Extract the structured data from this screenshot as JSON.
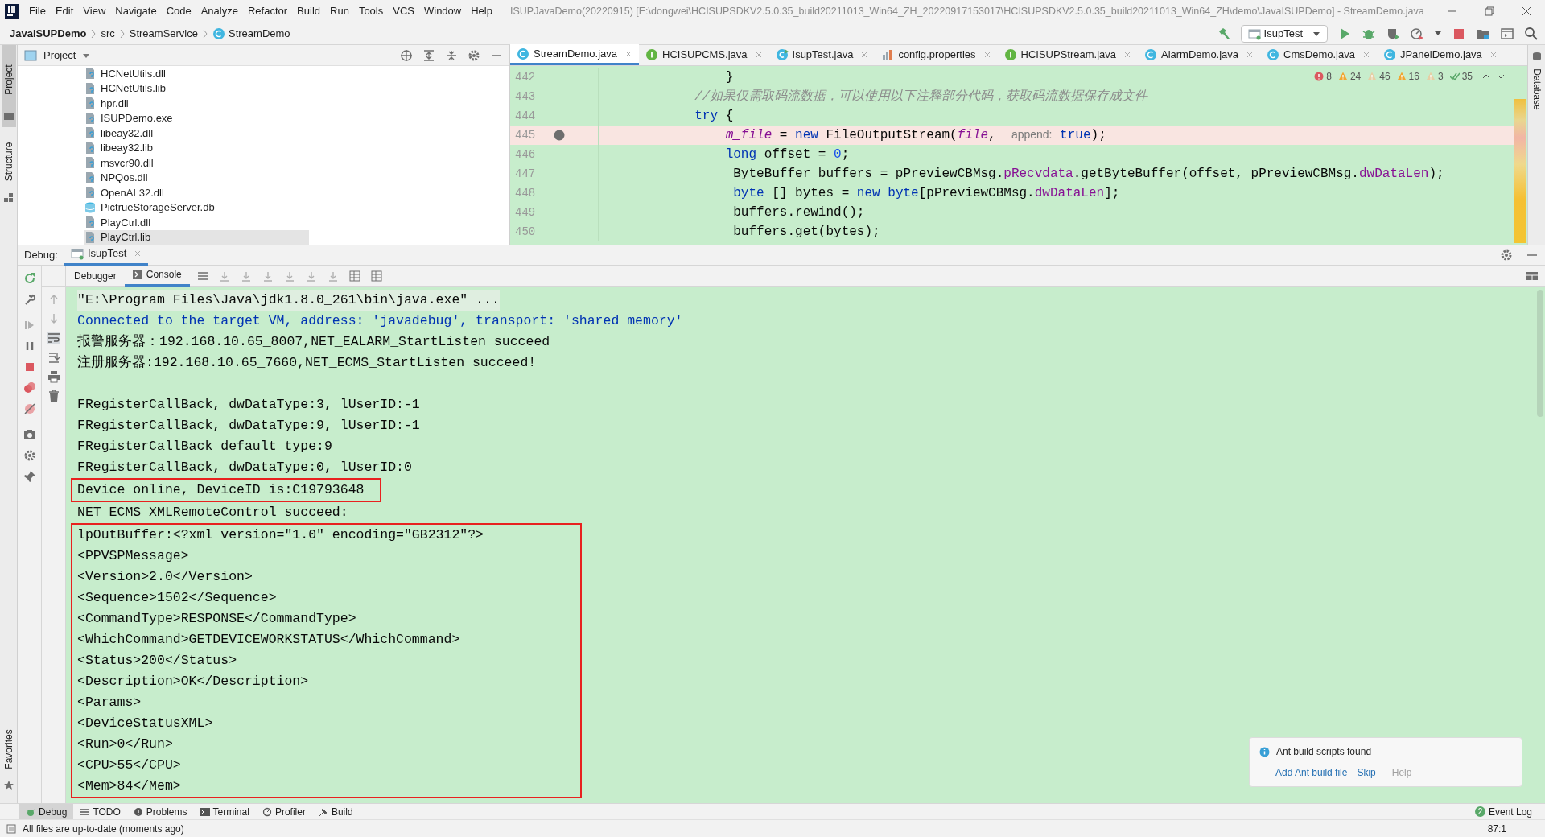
{
  "menu": [
    "File",
    "Edit",
    "View",
    "Navigate",
    "Code",
    "Analyze",
    "Refactor",
    "Build",
    "Run",
    "Tools",
    "VCS",
    "Window",
    "Help"
  ],
  "window": {
    "title": "ISUPJavaDemo(20220915) [E:\\dongwei\\HCISUPSDKV2.5.0.35_build20211013_Win64_ZH_20220917153017\\HCISUPSDKV2.5.0.35_build20211013_Win64_ZH\\demo\\JavaISUPDemo] - StreamDemo.java"
  },
  "breadcrumbs": [
    {
      "label": "JavaISUPDemo",
      "kind": "project"
    },
    {
      "label": "src",
      "kind": "folder"
    },
    {
      "label": "StreamService",
      "kind": "folder"
    },
    {
      "label": "StreamDemo",
      "kind": "class"
    }
  ],
  "run_config": "IsupTest",
  "left_strip": [
    "Project",
    "Structure"
  ],
  "project": {
    "title": "Project",
    "items": [
      {
        "label": "HCNetUtils.dll",
        "kind": "file",
        "selected": false
      },
      {
        "label": "HCNetUtils.lib",
        "kind": "file",
        "selected": false
      },
      {
        "label": "hpr.dll",
        "kind": "file",
        "selected": false
      },
      {
        "label": "ISUPDemo.exe",
        "kind": "file",
        "selected": false
      },
      {
        "label": "libeay32.dll",
        "kind": "file",
        "selected": false
      },
      {
        "label": "libeay32.lib",
        "kind": "file",
        "selected": false
      },
      {
        "label": "msvcr90.dll",
        "kind": "file",
        "selected": false
      },
      {
        "label": "NPQos.dll",
        "kind": "file",
        "selected": false
      },
      {
        "label": "OpenAL32.dll",
        "kind": "file",
        "selected": false
      },
      {
        "label": "PictrueStorageServer.db",
        "kind": "database",
        "selected": false
      },
      {
        "label": "PlayCtrl.dll",
        "kind": "file",
        "selected": false
      },
      {
        "label": "PlayCtrl.lib",
        "kind": "file",
        "selected": true
      }
    ]
  },
  "editor_tabs": [
    {
      "label": "StreamDemo.java",
      "kind": "class",
      "selected": true
    },
    {
      "label": "HCISUPCMS.java",
      "kind": "interface",
      "selected": false
    },
    {
      "label": "IsupTest.java",
      "kind": "runnable",
      "selected": false
    },
    {
      "label": "config.properties",
      "kind": "properties",
      "selected": false
    },
    {
      "label": "HCISUPStream.java",
      "kind": "interface",
      "selected": false
    },
    {
      "label": "AlarmDemo.java",
      "kind": "class",
      "selected": false
    },
    {
      "label": "CmsDemo.java",
      "kind": "class",
      "selected": false
    },
    {
      "label": "JPanelDemo.java",
      "kind": "class",
      "selected": false
    }
  ],
  "inspections": [
    {
      "count": "8",
      "kind": "error"
    },
    {
      "count": "24",
      "kind": "warning"
    },
    {
      "count": "46",
      "kind": "weak"
    },
    {
      "count": "16",
      "kind": "warning"
    },
    {
      "count": "3",
      "kind": "weak"
    },
    {
      "count": "35",
      "kind": "typo"
    }
  ],
  "right_strip": [
    "Database"
  ],
  "code": [
    {
      "number": "442",
      "breakpoint": false,
      "segments": [
        {
          "text": "                }",
          "kind": "plain"
        }
      ]
    },
    {
      "number": "443",
      "breakpoint": false,
      "segments": [
        {
          "text": "            //如果仅需取码流数据，可以使用以下注释部分代码，获取码流数据保存成文件",
          "kind": "comment"
        }
      ]
    },
    {
      "number": "444",
      "breakpoint": false,
      "segments": [
        {
          "text": "            try",
          "kind": "keyword"
        },
        {
          "text": " {",
          "kind": "plain"
        }
      ]
    },
    {
      "number": "445",
      "breakpoint": true,
      "segments": [
        {
          "text": "                m_file",
          "kind": "field_italic"
        },
        {
          "text": " = ",
          "kind": "plain"
        },
        {
          "text": "new",
          "kind": "keyword"
        },
        {
          "text": " FileOutputStream(",
          "kind": "plain"
        },
        {
          "text": "file",
          "kind": "field_italic"
        },
        {
          "text": ",  ",
          "kind": "plain"
        },
        {
          "text": "append:",
          "kind": "hint"
        },
        {
          "text": " true",
          "kind": "keyword"
        },
        {
          "text": ");",
          "kind": "plain"
        }
      ]
    },
    {
      "number": "446",
      "breakpoint": false,
      "segments": [
        {
          "text": "                long",
          "kind": "keyword"
        },
        {
          "text": " offset = ",
          "kind": "plain"
        },
        {
          "text": "0",
          "kind": "number"
        },
        {
          "text": ";",
          "kind": "plain"
        }
      ]
    },
    {
      "number": "447",
      "breakpoint": false,
      "segments": [
        {
          "text": "                 ByteBuffer buffers = pPreviewCBMsg.",
          "kind": "plain"
        },
        {
          "text": "pRecvdata",
          "kind": "field"
        },
        {
          "text": ".getByteBuffer(offset, pPreviewCBMsg.",
          "kind": "plain"
        },
        {
          "text": "dwDataLen",
          "kind": "field"
        },
        {
          "text": ");",
          "kind": "plain"
        }
      ]
    },
    {
      "number": "448",
      "breakpoint": false,
      "segments": [
        {
          "text": "                 byte",
          "kind": "keyword"
        },
        {
          "text": " [] bytes = ",
          "kind": "plain"
        },
        {
          "text": "new",
          "kind": "keyword"
        },
        {
          "text": " byte",
          "kind": "keyword"
        },
        {
          "text": "[pPreviewCBMsg.",
          "kind": "plain"
        },
        {
          "text": "dwDataLen",
          "kind": "field"
        },
        {
          "text": "];",
          "kind": "plain"
        }
      ]
    },
    {
      "number": "449",
      "breakpoint": false,
      "segments": [
        {
          "text": "                 buffers.rewind();",
          "kind": "plain"
        }
      ]
    },
    {
      "number": "450",
      "breakpoint": false,
      "segments": [
        {
          "text": "                 buffers.get(bytes);",
          "kind": "plain"
        }
      ]
    }
  ],
  "debug": {
    "label": "Debug:",
    "session_tab": "IsupTest",
    "subtabs": [
      {
        "label": "Debugger",
        "selected": false
      },
      {
        "label": "Console",
        "selected": true
      }
    ]
  },
  "console": [
    {
      "boxed": false,
      "lines": [
        {
          "text": "\"E:\\Program Files\\Java\\jdk1.8.0_261\\bin\\java.exe\" ...",
          "kind": "command"
        },
        {
          "text": "Connected to the target VM, address: 'javadebug', transport: 'shared memory'",
          "kind": "info"
        },
        {
          "text": "报警服务器：192.168.10.65_8007,NET_EALARM_StartListen succeed",
          "kind": "output"
        },
        {
          "text": "注册服务器:192.168.10.65_7660,NET_ECMS_StartListen succeed!",
          "kind": "output"
        },
        {
          "kind": "blank"
        },
        {
          "text": "FRegisterCallBack, dwDataType:3, lUserID:-1",
          "kind": "output"
        },
        {
          "text": "FRegisterCallBack, dwDataType:9, lUserID:-1",
          "kind": "output"
        },
        {
          "text": "FRegisterCallBack default type:9",
          "kind": "output"
        },
        {
          "text": "FRegisterCallBack, dwDataType:0, lUserID:0",
          "kind": "output"
        }
      ]
    },
    {
      "boxed": true,
      "lines": [
        {
          "text": "Device online, DeviceID is:C19793648",
          "kind": "output"
        }
      ]
    },
    {
      "boxed": false,
      "lines": [
        {
          "text": "NET_ECMS_XMLRemoteControl succeed:",
          "kind": "output"
        }
      ]
    },
    {
      "boxed": true,
      "lines": [
        {
          "text": "lpOutBuffer:<?xml version=\"1.0\" encoding=\"GB2312\"?>",
          "kind": "output"
        },
        {
          "text": "<PPVSPMessage>",
          "kind": "output"
        },
        {
          "text": "<Version>2.0</Version>",
          "kind": "output"
        },
        {
          "text": "<Sequence>1502</Sequence>",
          "kind": "output"
        },
        {
          "text": "<CommandType>RESPONSE</CommandType>",
          "kind": "output"
        },
        {
          "text": "<WhichCommand>GETDEVICEWORKSTATUS</WhichCommand>",
          "kind": "output"
        },
        {
          "text": "<Status>200</Status>",
          "kind": "output"
        },
        {
          "text": "<Description>OK</Description>",
          "kind": "output"
        },
        {
          "text": "<Params>",
          "kind": "output"
        },
        {
          "text": "<DeviceStatusXML>",
          "kind": "output"
        },
        {
          "text": "<Run>0</Run>",
          "kind": "output"
        },
        {
          "text": "<CPU>55</CPU>",
          "kind": "output"
        },
        {
          "text": "<Mem>84</Mem>",
          "kind": "output"
        }
      ]
    }
  ],
  "favorites": "Favorites",
  "notification": {
    "title": "Ant build scripts found",
    "actions": [
      {
        "label": "Add Ant build file",
        "disabled": false
      },
      {
        "label": "Skip",
        "disabled": false
      },
      {
        "label": "Help",
        "disabled": true
      }
    ]
  },
  "tool_windows": [
    {
      "label": "Debug",
      "selected": true
    },
    {
      "label": "TODO",
      "selected": false
    },
    {
      "label": "Problems",
      "selected": false
    },
    {
      "label": "Terminal",
      "selected": false
    },
    {
      "label": "Profiler",
      "selected": false
    },
    {
      "label": "Build",
      "selected": false
    }
  ],
  "event_log": {
    "label": "Event Log",
    "badge": "2"
  },
  "status_bar": {
    "message": "All files are up-to-date (moments ago)",
    "position": "87:1"
  }
}
